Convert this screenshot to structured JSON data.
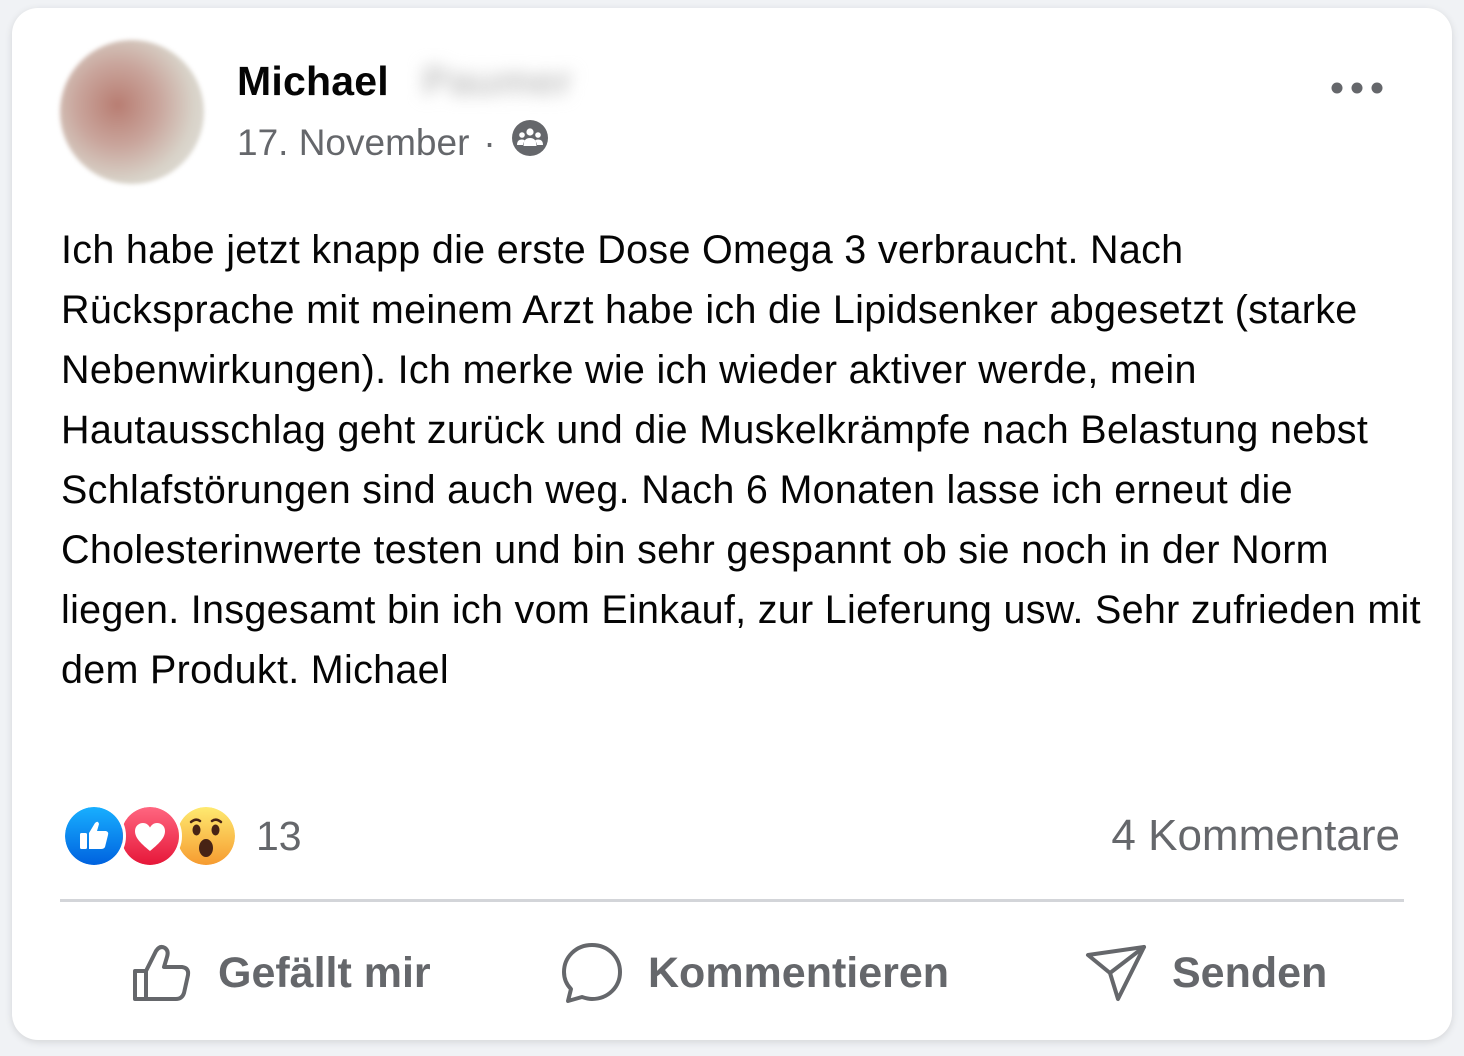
{
  "post": {
    "author_first_name": "Michael",
    "author_last_name_blurred": "Paumer",
    "date": "17. November",
    "separator": "·",
    "audience_icon": "group-icon",
    "text": "Ich habe jetzt knapp die erste Dose Omega 3 verbraucht. Nach Rücksprache mit meinem Arzt habe ich die Lipidsenker abgesetzt (starke Nebenwirkungen). Ich merke wie ich wieder aktiver werde, mein Hautausschlag geht zurück und die Muskelkrämpfe nach Belastung nebst Schlafstörungen sind auch weg. Nach 6 Monaten lasse ich erneut die Cholesterinwerte testen und bin sehr gespannt ob sie noch in der Norm liegen. Insgesamt bin ich vom Einkauf, zur Lieferung usw. Sehr zufrieden mit dem Produkt. Michael"
  },
  "reactions": {
    "icons": [
      "like-icon",
      "love-icon",
      "wow-icon"
    ],
    "count": "13"
  },
  "comments": {
    "label": "4 Kommentare"
  },
  "actions": {
    "like_label": "Gefällt mir",
    "comment_label": "Kommentieren",
    "share_label": "Senden"
  },
  "colors": {
    "like_blue": "#1877f2",
    "love_red": "#f33e58",
    "wow_yellow": "#f7b125",
    "secondary_text": "#65676b"
  }
}
